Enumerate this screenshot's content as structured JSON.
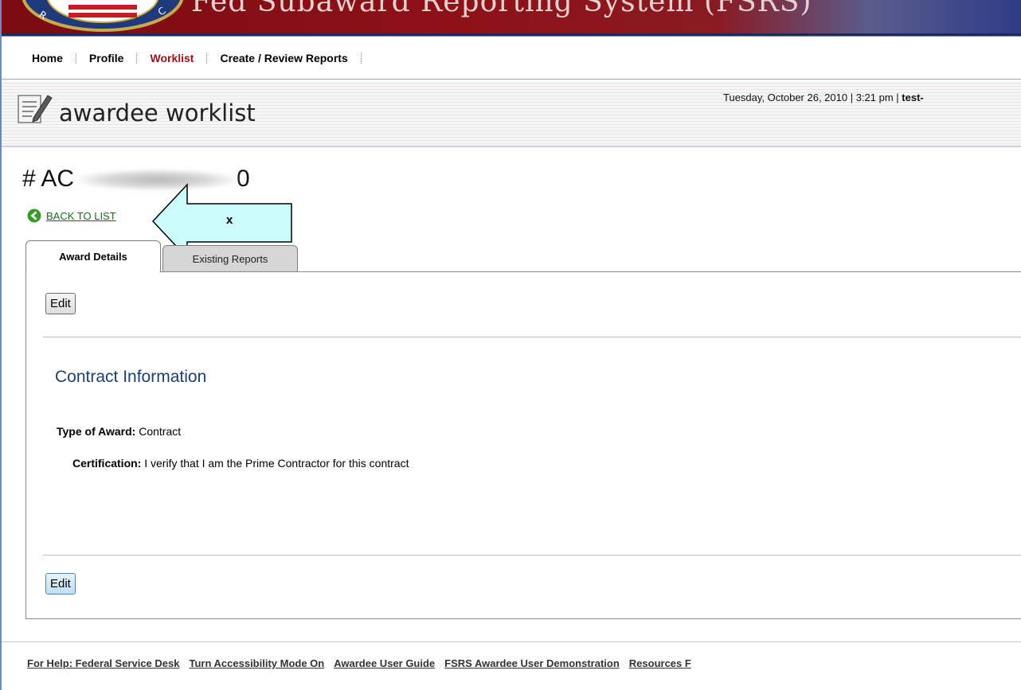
{
  "banner": {
    "title": "Fed Subaward Reporting System (FSRS)"
  },
  "nav": {
    "items": [
      {
        "label": "Home"
      },
      {
        "label": "Profile"
      },
      {
        "label": "Worklist"
      },
      {
        "label": "Create / Review Reports"
      }
    ],
    "active": "Worklist"
  },
  "header": {
    "page_title": "awardee worklist",
    "datetime": "Tuesday, October 26, 2010 | 3:21 pm |",
    "user": "test-"
  },
  "award": {
    "number_prefix": "# AC",
    "number_suffix": "0",
    "back_link": "BACK TO LIST"
  },
  "annotation": {
    "label": "x"
  },
  "tabs": [
    {
      "label": "Award Details",
      "active": true
    },
    {
      "label": "Existing Reports",
      "active": false
    }
  ],
  "panel": {
    "edit_top": "Edit",
    "edit_bottom": "Edit",
    "section_title": "Contract Information",
    "fields": [
      {
        "label": "Type of Award:",
        "value": "Contract"
      },
      {
        "label": "Certification:",
        "value": "I verify that I am the Prime Contractor for this contract"
      }
    ]
  },
  "footer": {
    "links": [
      "For Help: Federal Service Desk",
      "Turn Accessibility Mode On",
      "Awardee User Guide",
      "FSRS Awardee User Demonstration",
      "Resources F"
    ]
  },
  "colors": {
    "banner": "#8e1118",
    "active_nav": "#9a1118",
    "link_green": "#1a6e1a",
    "section_blue": "#1d3f73"
  }
}
